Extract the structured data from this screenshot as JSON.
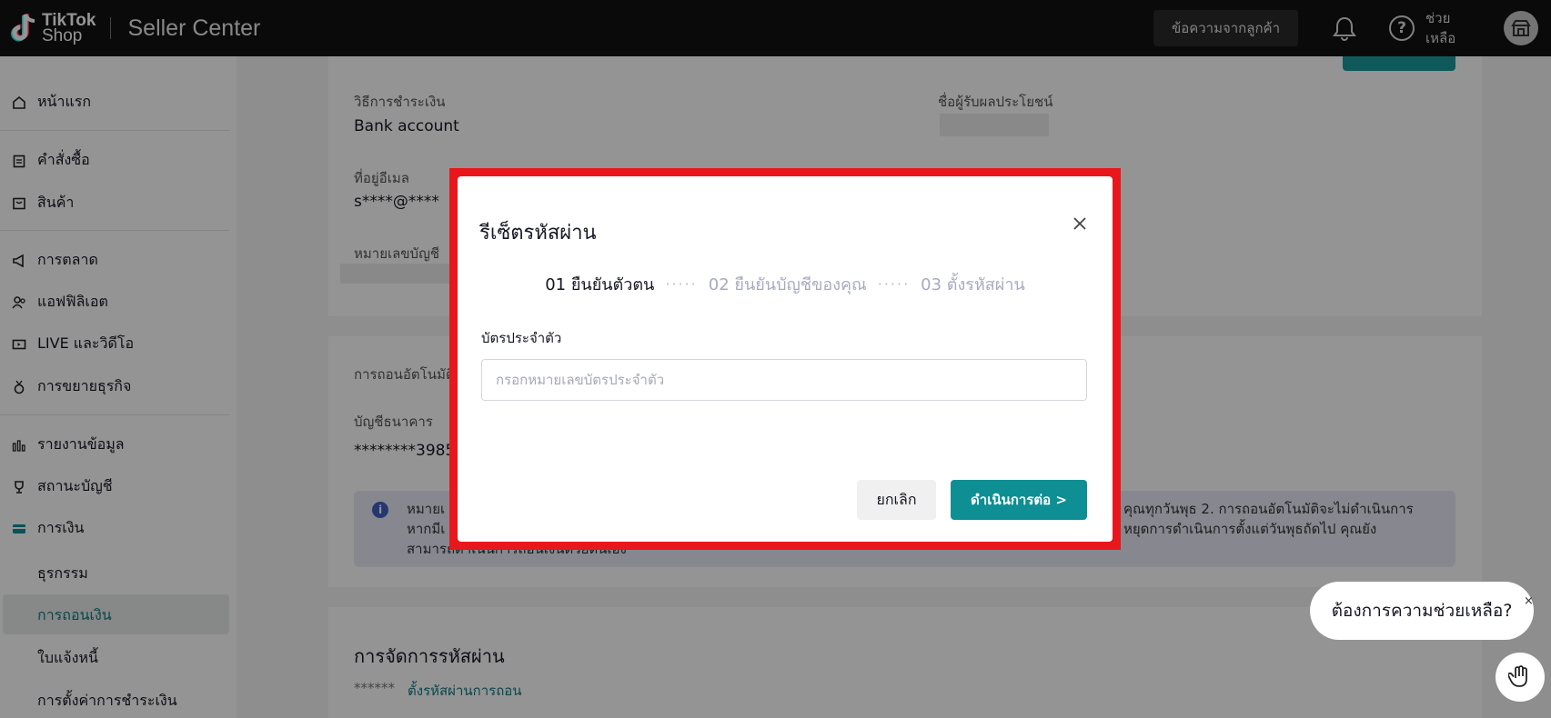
{
  "header": {
    "brand_line1": "TikTok",
    "brand_line2": "Shop",
    "product": "Seller Center",
    "message_button": "ข้อความจากลูกค้า",
    "help_label": "ช่วยเหลือ"
  },
  "sidebar": {
    "items": [
      {
        "label": "หน้าแรก",
        "icon": "home-icon"
      },
      {
        "label": "คำสั่งซื้อ",
        "icon": "clipboard-icon"
      },
      {
        "label": "สินค้า",
        "icon": "box-icon"
      },
      {
        "label": "การตลาด",
        "icon": "megaphone-icon"
      },
      {
        "label": "แอฟฟิลิเอต",
        "icon": "users-icon"
      },
      {
        "label": "LIVE และวิดีโอ",
        "icon": "video-icon"
      },
      {
        "label": "การขยายธุรกิจ",
        "icon": "medal-icon"
      },
      {
        "label": "รายงานข้อมูล",
        "icon": "bar-chart-icon"
      },
      {
        "label": "สถานะบัญชี",
        "icon": "trophy-icon"
      },
      {
        "label": "การเงิน",
        "icon": "card-icon"
      }
    ],
    "finance_sub": [
      {
        "label": "ธุรกรรม"
      },
      {
        "label": "การถอนเงิน"
      },
      {
        "label": "ใบแจ้งหนี้"
      },
      {
        "label": "การตั้งค่าการชำระเงิน"
      }
    ]
  },
  "main": {
    "payment_method_label": "วิธีการชำระเงิน",
    "payment_method_value": "Bank account",
    "beneficiary_label": "ชื่อผู้รับผลประโยชน์",
    "email_label": "ที่อยู่อีเมล",
    "email_value": "s****@****",
    "account_number_label": "หมายเลขบัญชี",
    "auto_withdraw_label": "การถอนอัตโนมัติ",
    "bank_account_label": "บัญชีธนาคาร",
    "bank_account_value": "********3985",
    "info_line1_left": "หมายเ",
    "info_line1_right": "คุณทุกวันพุธ 2. การถอนอัตโนมัติจะไม่ดำเนินการ",
    "info_line2_left": "หากมีเ",
    "info_line2_right": "หยุดการดำเนินการตั้งแต่วันพุธถัดไป คุณยัง",
    "info_line3_left": "สามารถดำเนินการถอนเงินด้วยตนเอง",
    "password_section_title": "การจัดการรหัสผ่าน",
    "password_masked": "******",
    "password_link": "ตั้งรหัสผ่านการถอน"
  },
  "modal": {
    "title": "รีเซ็ตรหัสผ่าน",
    "steps": [
      "01 ยืนยันตัวตน",
      "02 ยืนยันบัญชีของคุณ",
      "03 ตั้งรหัสผ่าน"
    ],
    "step_separator": "·····",
    "active_step": 1,
    "field_label": "บัตรประจำตัว",
    "field_placeholder": "กรอกหมายเลขบัตรประจำตัว",
    "field_value": "",
    "cancel_label": "ยกเลิก",
    "continue_label": "ดำเนินการต่อ >"
  },
  "help_widget": {
    "bubble_text": "ต้องการความช่วยเหลือ?",
    "close_glyph": "×"
  },
  "colors": {
    "accent": "#0d8f94",
    "highlight_frame": "#e8171c",
    "topbar": "#121212"
  }
}
